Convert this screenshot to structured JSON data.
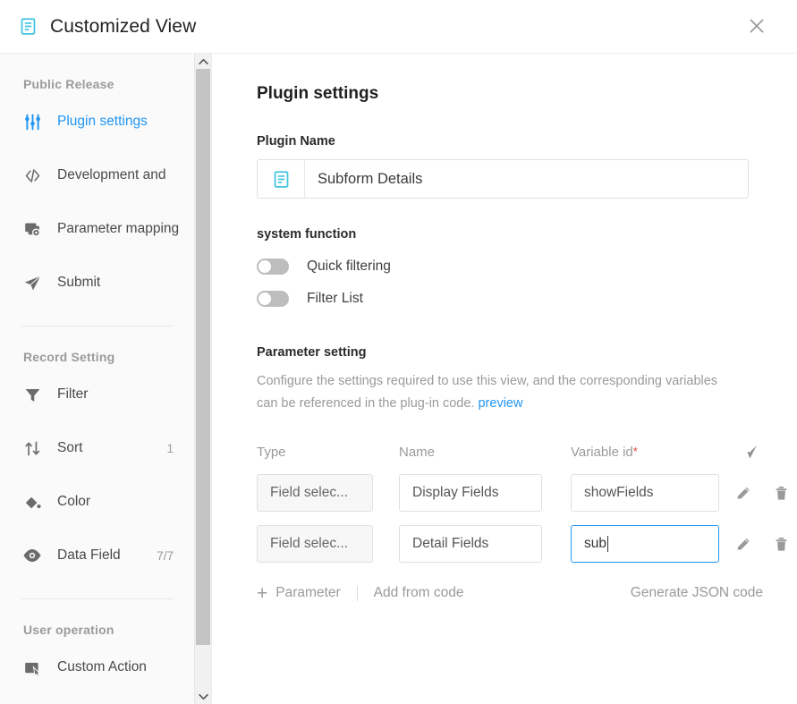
{
  "titlebar": {
    "icon": "document-list-icon",
    "title": "Customized View",
    "close_icon": "close-icon"
  },
  "sidebar": {
    "groups": [
      {
        "title": "Public Release",
        "items": [
          {
            "icon": "sliders-icon",
            "label": "Plugin settings",
            "badge": "",
            "active": true
          },
          {
            "icon": "code-brackets-icon",
            "label": "Development and",
            "badge": "",
            "active": false
          },
          {
            "icon": "parameter-mapping-icon",
            "label": "Parameter mapping",
            "badge": "",
            "active": false
          },
          {
            "icon": "paper-plane-icon",
            "label": "Submit",
            "badge": "",
            "active": false
          }
        ]
      },
      {
        "title": "Record Setting",
        "items": [
          {
            "icon": "funnel-icon",
            "label": "Filter",
            "badge": "",
            "active": false
          },
          {
            "icon": "sort-icon",
            "label": "Sort",
            "badge": "1",
            "active": false
          },
          {
            "icon": "paint-can-icon",
            "label": "Color",
            "badge": "",
            "active": false
          },
          {
            "icon": "eye-icon",
            "label": "Data Field",
            "badge": "7/7",
            "active": false
          }
        ]
      },
      {
        "title": "User operation",
        "items": [
          {
            "icon": "custom-action-icon",
            "label": "Custom Action",
            "badge": "",
            "active": false
          }
        ]
      }
    ],
    "scrollbar": {
      "up_arrow_icon": "chevron-up-icon",
      "down_arrow_icon": "chevron-down-icon"
    }
  },
  "main": {
    "panel_title": "Plugin settings",
    "plugin_name": {
      "label": "Plugin Name",
      "icon": "document-list-icon",
      "value": "Subform Details",
      "placeholder": "Plugin Name"
    },
    "system_function": {
      "heading": "system function",
      "toggles": [
        {
          "label": "Quick filtering",
          "on": false
        },
        {
          "label": "Filter List",
          "on": false
        }
      ]
    },
    "parameter_setting": {
      "heading": "Parameter setting",
      "description": "Configure the settings required to use this view, and the corresponding variables can be referenced in the plug-in code.",
      "preview_link": "preview",
      "columns": {
        "type": "Type",
        "name": "Name",
        "variable_id": "Variable id",
        "required_mark": "*",
        "action_icon": "clear-broom-icon"
      },
      "rows": [
        {
          "type": "Field selec...",
          "name": "Display Fields",
          "variable_id": "showFields",
          "focused": false,
          "edit_icon": "pencil-icon",
          "delete_icon": "trash-icon"
        },
        {
          "type": "Field selec...",
          "name": "Detail Fields",
          "variable_id": "sub",
          "focused": true,
          "edit_icon": "pencil-icon",
          "delete_icon": "trash-icon"
        }
      ],
      "footer": {
        "add_parameter": "Parameter",
        "add_parameter_icon": "plus-icon",
        "add_from_code": "Add from code",
        "generate_json": "Generate JSON code"
      }
    }
  },
  "colors": {
    "accent_blue": "#2196f3",
    "icon_cyan": "#40c4e0",
    "required_red": "#e8443a",
    "muted_text": "#9a9a9a",
    "sidebar_bg": "#fafafa"
  }
}
